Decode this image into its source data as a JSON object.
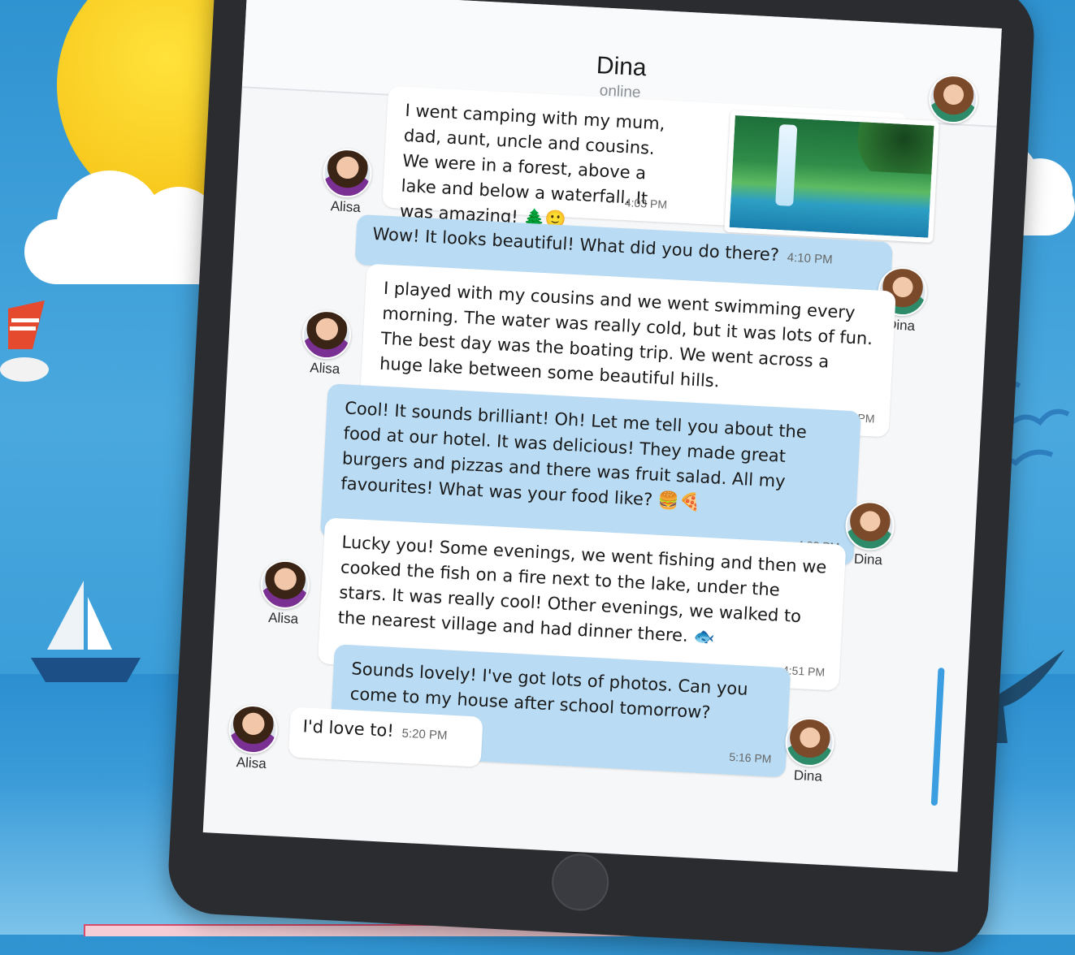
{
  "chat": {
    "contact_name": "Dina",
    "contact_status": "online"
  },
  "people": {
    "alisa": "Alisa",
    "dina": "Dina"
  },
  "messages": [
    {
      "sender": "Alisa",
      "text": "I went camping with my mum, dad, aunt, uncle and cousins. We were in a forest, above a lake and below a waterfall. It was amazing! 🌲🙂",
      "time": "4:03 PM",
      "has_photo": true
    },
    {
      "sender": "Dina",
      "text": "Wow! It looks beautiful! What did you do there?",
      "time": "4:10 PM"
    },
    {
      "sender": "Alisa",
      "text": "I played with my cousins and we went swimming every morning. The water was really cold, but it was lots of fun. The best day was the boating trip. We went across a huge lake between some beautiful hills.",
      "time": "4:12 PM"
    },
    {
      "sender": "Dina",
      "text": "Cool! It sounds brilliant! Oh! Let me tell you about the food at our hotel. It was delicious! They made great burgers and pizzas and there was fruit salad. All my favourites! What was your food like? 🍔🍕",
      "time": "4:32 PM"
    },
    {
      "sender": "Alisa",
      "text": "Lucky you! Some evenings, we went fishing and then we cooked the fish on a fire next to the lake, under the stars. It was really cool! Other evenings, we walked to the nearest village and had dinner there. 🐟",
      "time": "4:51 PM"
    },
    {
      "sender": "Dina",
      "text": "Sounds lovely! I've got lots of photos. Can you come to my house after school tomorrow?",
      "time": "5:16 PM"
    },
    {
      "sender": "Alisa",
      "text": "I'd love to!",
      "time": "5:20 PM"
    }
  ],
  "icons": {
    "photo": "waterfall-photo",
    "home": "home-button-icon"
  },
  "colors": {
    "incoming_bubble": "#ffffff",
    "outgoing_bubble": "#b9dcf4",
    "scrollbar": "#3a9ee0",
    "tablet_frame": "#2b2c30"
  }
}
